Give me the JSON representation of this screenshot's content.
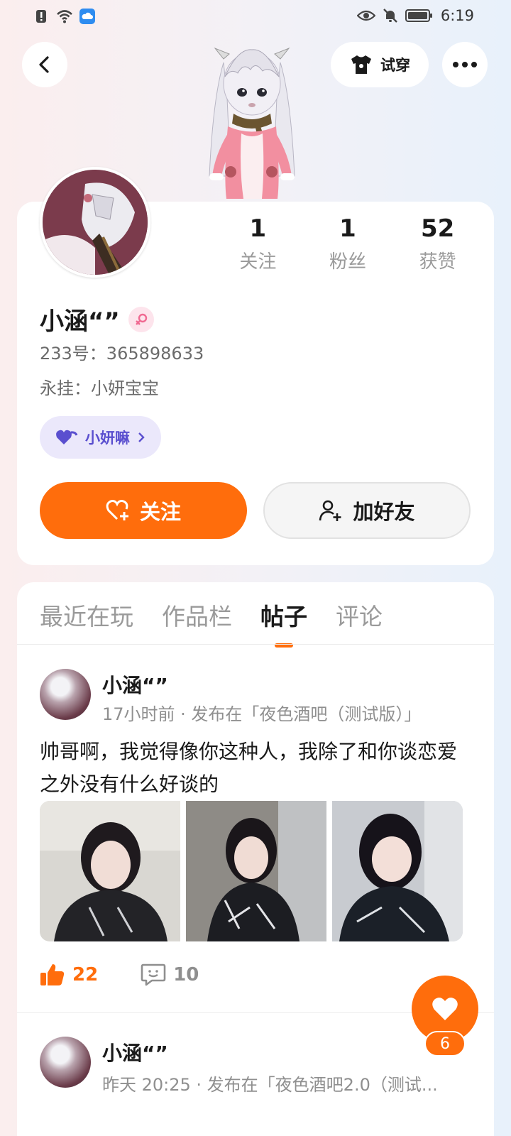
{
  "status_bar": {
    "time": "6:19"
  },
  "header": {
    "try_on_label": "试穿"
  },
  "profile": {
    "stats": [
      {
        "value": "1",
        "label": "关注"
      },
      {
        "value": "1",
        "label": "粉丝"
      },
      {
        "value": "52",
        "label": "获赞"
      }
    ],
    "name": "小涵“”",
    "id_line": "233号：365898633",
    "pin_line": "永挂：小妍宝宝",
    "club_label": "小妍嘛",
    "follow_label": "关注",
    "add_friend_label": "加好友"
  },
  "tabs": [
    {
      "label": "最近在玩"
    },
    {
      "label": "作品栏"
    },
    {
      "label": "帖子"
    },
    {
      "label": "评论"
    }
  ],
  "posts": [
    {
      "author": "小涵“”",
      "meta": "17小时前 · 发布在「夜色酒吧（测试版）」",
      "text": "帅哥啊，我觉得像你这种人，我除了和你谈恋爱之外没有什么好谈的",
      "likes": "22",
      "comments": "10"
    },
    {
      "author": "小涵“”",
      "meta": "昨天 20:25 · 发布在「夜色酒吧2.0（测试..."
    }
  ],
  "fab": {
    "count": "6"
  },
  "colors": {
    "accent": "#ff6d0c",
    "club_purple": "#5a4fcf"
  }
}
